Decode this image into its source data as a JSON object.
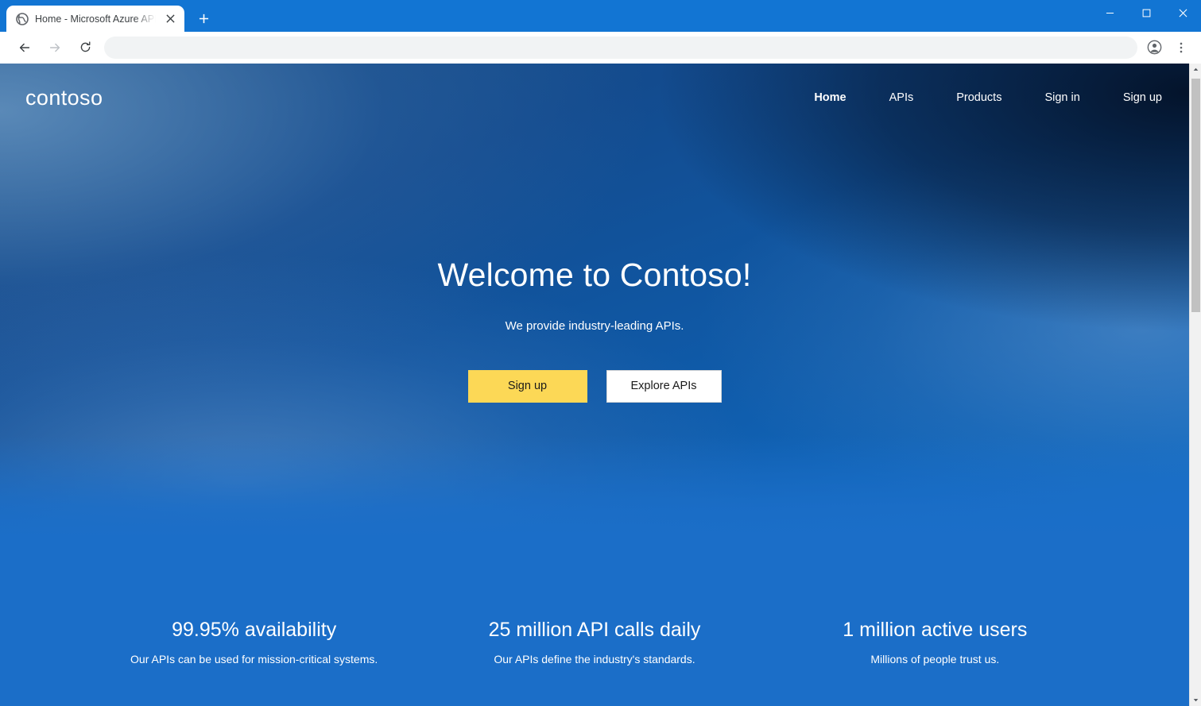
{
  "browser": {
    "tab": {
      "title": "Home - Microsoft Azure API Man",
      "favicon_name": "globe-icon",
      "close_label": "✕"
    },
    "new_tab_label": "+",
    "window_controls": {
      "minimize": "—",
      "maximize": "□",
      "close": "✕"
    },
    "toolbar": {
      "back_label": "←",
      "forward_label": "→",
      "reload_label": "⟳",
      "address_value": "",
      "address_placeholder": "",
      "profile_label": "profile",
      "menu_label": "⋮"
    }
  },
  "site": {
    "logo": "contoso",
    "nav": [
      {
        "label": "Home",
        "active": true
      },
      {
        "label": "APIs",
        "active": false
      },
      {
        "label": "Products",
        "active": false
      },
      {
        "label": "Sign in",
        "active": false
      },
      {
        "label": "Sign up",
        "active": false
      }
    ],
    "hero": {
      "title": "Welcome to Contoso!",
      "subtitle": "We provide industry-leading APIs.",
      "primary_button": "Sign up",
      "secondary_button": "Explore APIs"
    },
    "stats": [
      {
        "title": "99.95% availability",
        "description": "Our APIs can be used for mission-critical systems."
      },
      {
        "title": "25 million API calls daily",
        "description": "Our APIs define the industry's standards."
      },
      {
        "title": "1 million active users",
        "description": "Millions of people trust us."
      }
    ]
  },
  "colors": {
    "browser_frame": "#1275d3",
    "hero_dark": "#0a1c38",
    "hero_blue": "#1470c9",
    "stats_band": "#1b6ec8",
    "accent_yellow": "#fcd856",
    "button_white": "#ffffff"
  }
}
